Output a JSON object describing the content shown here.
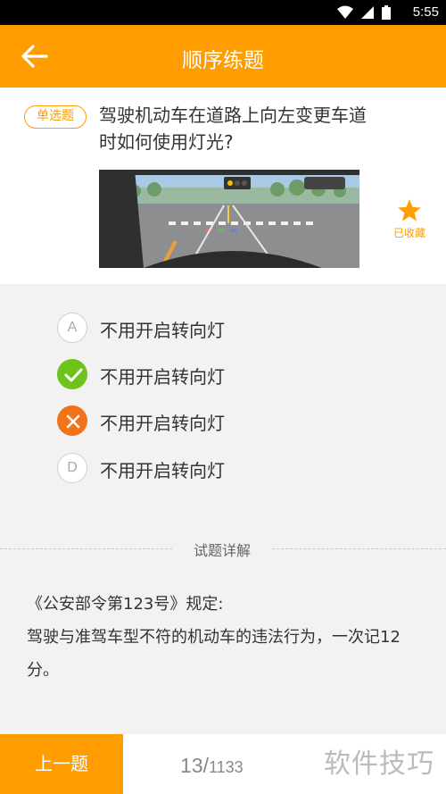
{
  "status_bar": {
    "time": "5:55"
  },
  "header": {
    "title": "顺序练题"
  },
  "question": {
    "type_badge": "单选题",
    "text": "驾驶机动车在道路上向左变更车道时如何使用灯光?",
    "favorite_label": "已收藏"
  },
  "options": [
    {
      "letter": "A",
      "text": "不用开启转向灯",
      "state": "default"
    },
    {
      "letter": "B",
      "text": "不用开启转向灯",
      "state": "correct"
    },
    {
      "letter": "C",
      "text": "不用开启转向灯",
      "state": "wrong"
    },
    {
      "letter": "D",
      "text": "不用开启转向灯",
      "state": "default"
    }
  ],
  "explanation": {
    "title": "试题详解",
    "line1": "《公安部令第123号》规定:",
    "line2": "驾驶与准驾车型不符的机动车的违法行为，一次记12分。"
  },
  "footer": {
    "prev_label": "上一题",
    "current": "13",
    "separator": "/",
    "total": "1133",
    "watermark": "软件技巧"
  },
  "colors": {
    "accent": "#ff9c00",
    "correct": "#6dc31c",
    "wrong": "#f0731a"
  }
}
